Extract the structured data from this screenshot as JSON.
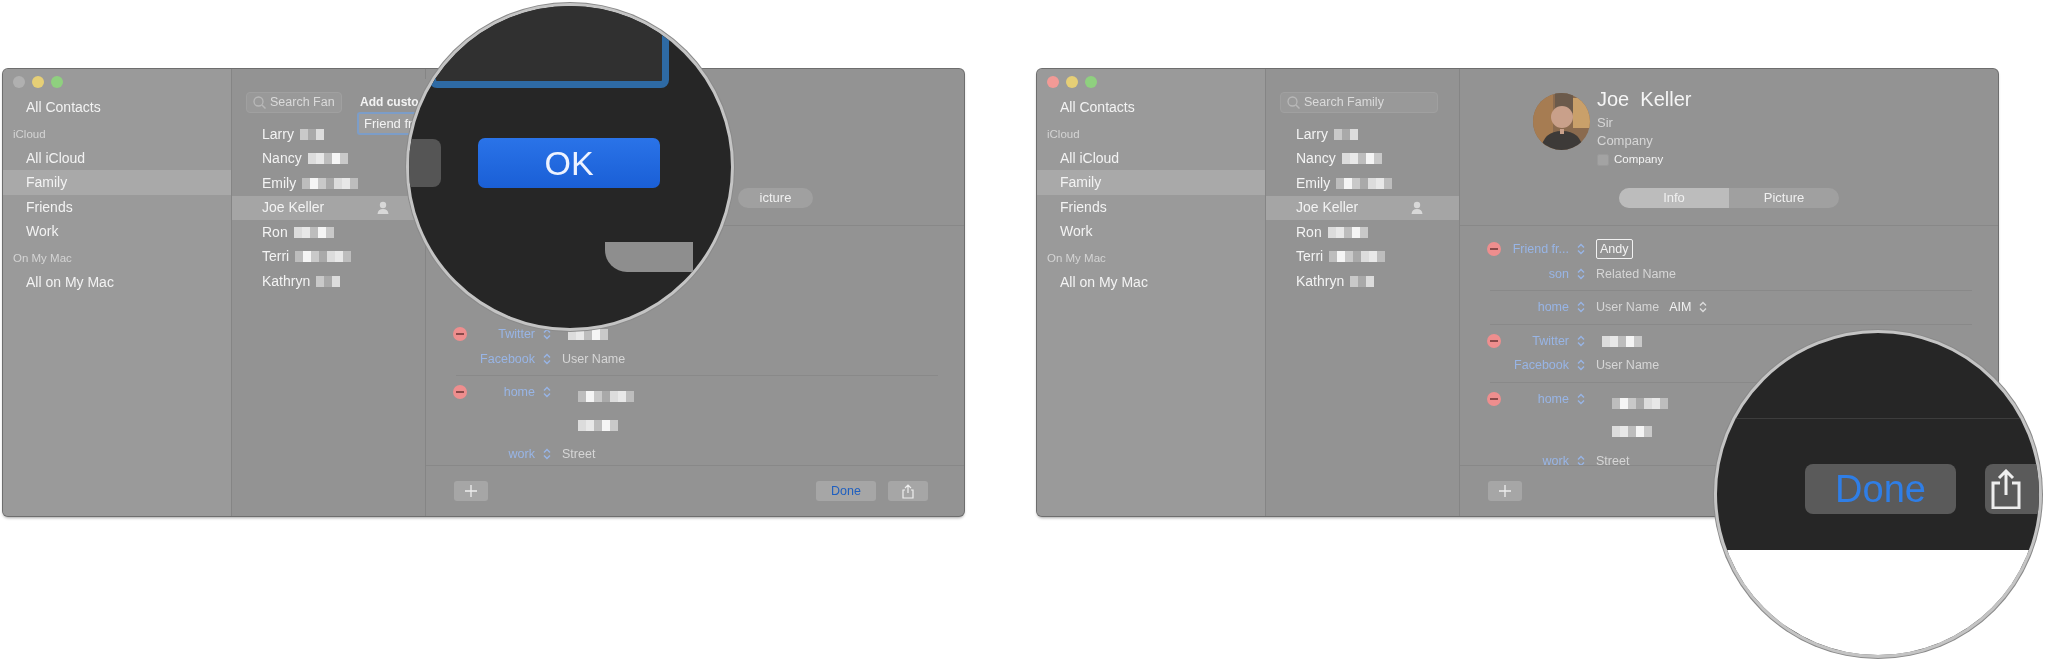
{
  "windows": [
    {
      "close_active": false,
      "sidebar": {
        "items": [
          {
            "kind": "item",
            "label": "All Contacts",
            "selected": false
          },
          {
            "kind": "header",
            "label": "iCloud"
          },
          {
            "kind": "item",
            "label": "All iCloud",
            "selected": false
          },
          {
            "kind": "item",
            "label": "Family",
            "selected": true
          },
          {
            "kind": "item",
            "label": "Friends",
            "selected": false
          },
          {
            "kind": "item",
            "label": "Work",
            "selected": false
          },
          {
            "kind": "header",
            "label": "On My Mac"
          },
          {
            "kind": "item",
            "label": "All on My Mac",
            "selected": false
          }
        ]
      },
      "search": {
        "placeholder": "Search Fan"
      },
      "contacts": [
        {
          "name": "Larry",
          "selected": false,
          "me": false
        },
        {
          "name": "Nancy",
          "selected": false,
          "me": false
        },
        {
          "name": "Emily",
          "selected": false,
          "me": false
        },
        {
          "name": "Joe Keller",
          "selected": true,
          "me": true
        },
        {
          "name": "Ron",
          "selected": false,
          "me": false
        },
        {
          "name": "Terri",
          "selected": false,
          "me": false
        },
        {
          "name": "Kathryn",
          "selected": false,
          "me": false
        }
      ],
      "detail": {
        "sheet": {
          "title": "Add custo",
          "value": "Friend fr"
        },
        "segments": [
          {
            "label": "icture",
            "selected": false
          }
        ],
        "rows": [
          {
            "kind": "field",
            "removable": true,
            "label": "Twitter",
            "redacted": true
          },
          {
            "kind": "field",
            "removable": false,
            "label": "Facebook",
            "placeholder": "User Name"
          },
          {
            "kind": "address",
            "removable": true,
            "label": "home",
            "redacted": true,
            "divider_before": true
          },
          {
            "kind": "field",
            "removable": false,
            "label": "work",
            "placeholder": "Street"
          }
        ],
        "footer": {
          "add": true,
          "done": "Done",
          "share": true
        }
      },
      "magnifier": {
        "kind": "ok",
        "button": "OK"
      }
    },
    {
      "close_active": true,
      "sidebar": {
        "items": [
          {
            "kind": "item",
            "label": "All Contacts",
            "selected": false
          },
          {
            "kind": "header",
            "label": "iCloud"
          },
          {
            "kind": "item",
            "label": "All iCloud",
            "selected": false
          },
          {
            "kind": "item",
            "label": "Family",
            "selected": true
          },
          {
            "kind": "item",
            "label": "Friends",
            "selected": false
          },
          {
            "kind": "item",
            "label": "Work",
            "selected": false
          },
          {
            "kind": "header",
            "label": "On My Mac"
          },
          {
            "kind": "item",
            "label": "All on My Mac",
            "selected": false
          }
        ]
      },
      "search": {
        "placeholder": "Search Family"
      },
      "contacts": [
        {
          "name": "Larry",
          "selected": false,
          "me": false
        },
        {
          "name": "Nancy",
          "selected": false,
          "me": false
        },
        {
          "name": "Emily",
          "selected": false,
          "me": false
        },
        {
          "name": "Joe Keller",
          "selected": true,
          "me": true
        },
        {
          "name": "Ron",
          "selected": false,
          "me": false
        },
        {
          "name": "Terri",
          "selected": false,
          "me": false
        },
        {
          "name": "Kathryn",
          "selected": false,
          "me": false
        }
      ],
      "detail": {
        "card": {
          "name": "Joe  Keller",
          "title_placeholder": "Sir",
          "company_placeholder": "Company",
          "company_checkbox": {
            "label": "Company",
            "checked": false
          }
        },
        "segments": [
          {
            "label": "Info",
            "selected": true
          },
          {
            "label": "Picture",
            "selected": false
          }
        ],
        "rows": [
          {
            "kind": "field",
            "removable": true,
            "label": "Friend fr...",
            "value": "Andy",
            "editing": true
          },
          {
            "kind": "field",
            "removable": false,
            "label": "son",
            "placeholder": "Related Name"
          },
          {
            "kind": "field",
            "removable": false,
            "label": "home",
            "placeholder": "User Name",
            "service": "AIM",
            "divider_before": true
          },
          {
            "kind": "field",
            "removable": true,
            "label": "Twitter",
            "redacted": true,
            "divider_before": true
          },
          {
            "kind": "field",
            "removable": false,
            "label": "Facebook",
            "placeholder": "User Name"
          },
          {
            "kind": "address",
            "removable": true,
            "label": "home",
            "redacted": true,
            "divider_before": true
          },
          {
            "kind": "field",
            "removable": false,
            "label": "work",
            "placeholder": "Street"
          }
        ],
        "footer": {
          "add": true
        }
      },
      "magnifier": {
        "kind": "done",
        "button": "Done",
        "share": true
      }
    }
  ]
}
